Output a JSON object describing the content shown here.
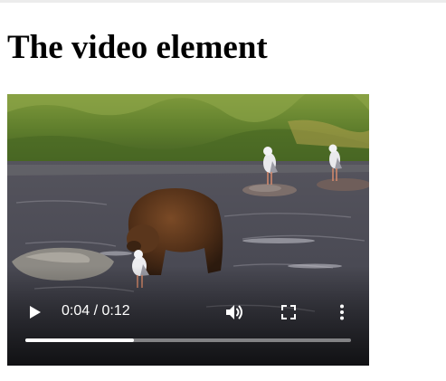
{
  "page": {
    "heading": "The video element"
  },
  "video": {
    "controls": {
      "current_time": "0:04",
      "duration": "0:12",
      "time_display": "0:04 / 0:12",
      "progress_fraction": 0.3333,
      "icons": {
        "play": "play-icon",
        "volume": "volume-icon",
        "fullscreen": "fullscreen-icon",
        "more": "more-options-icon"
      }
    }
  },
  "colors": {
    "control_foreground": "#ffffff",
    "progress_track": "rgba(255,255,255,0.45)",
    "progress_fill": "#ffffff"
  }
}
